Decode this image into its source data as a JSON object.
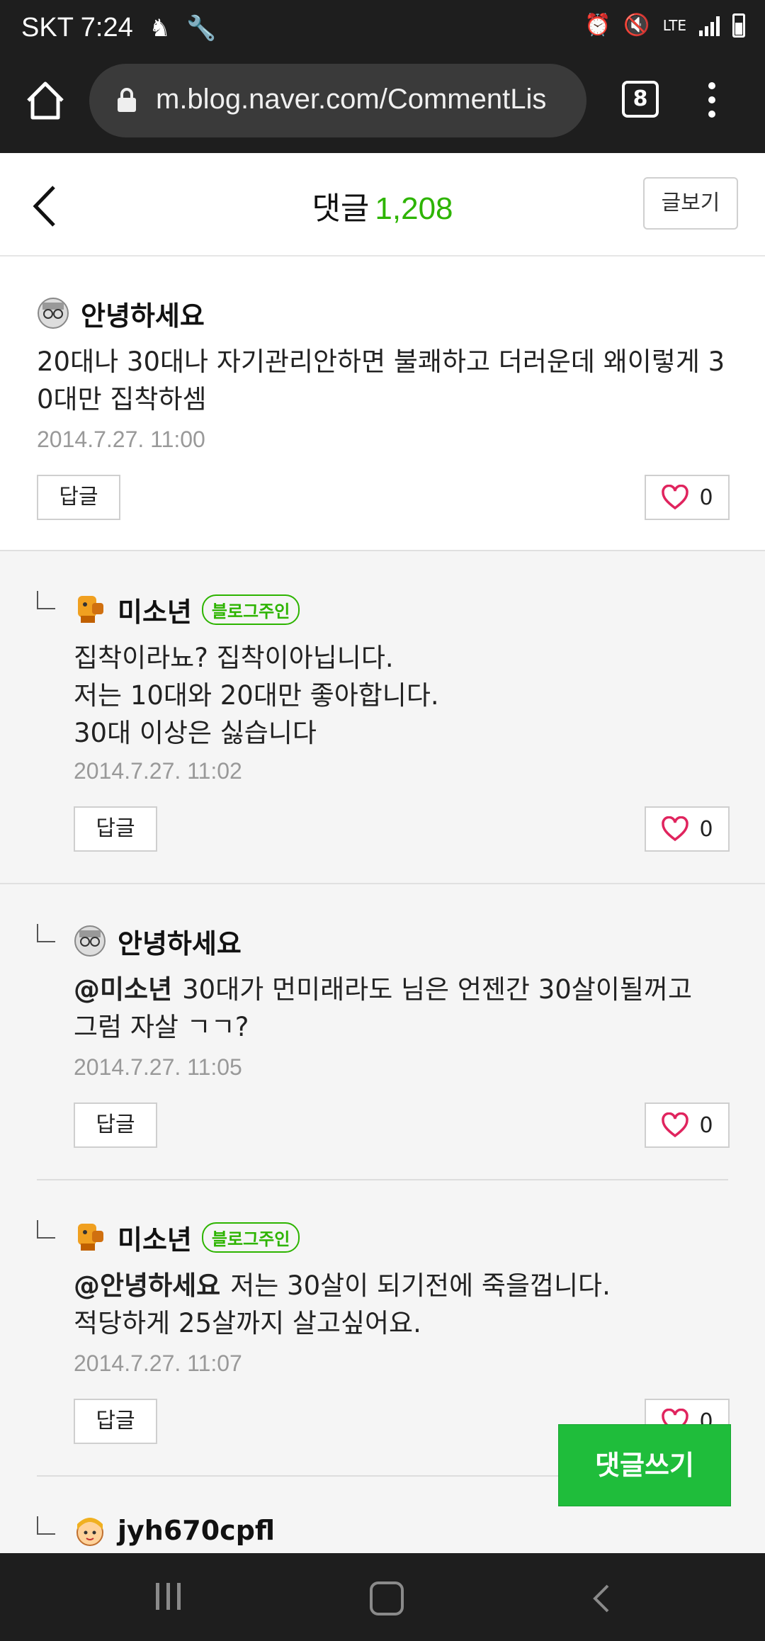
{
  "status_bar": {
    "carrier": "SKT",
    "time": "7:24",
    "network": "LTE"
  },
  "browser": {
    "url": "m.blog.naver.com/CommentLis",
    "tab_count": "8"
  },
  "header": {
    "title": "댓글",
    "count": "1,208",
    "view_post_label": "글보기"
  },
  "comments": [
    {
      "author": "안녕하세요",
      "text": "20대나 30대나 자기관리안하면 불쾌하고 더러운데 왜이렇게 3\n0대만 집착하셈",
      "date": "2014.7.27. 11:00",
      "reply_label": "답글",
      "likes": "0"
    },
    {
      "author": "미소년",
      "badge": "블로그주인",
      "text": "집착이라뇨? 집착이아닙니다.\n저는 10대와 20대만 좋아합니다.\n30대 이상은 싫습니다",
      "date": "2014.7.27. 11:02",
      "reply_label": "답글",
      "likes": "0"
    },
    {
      "author": "안녕하세요",
      "mention": "@미소년",
      "text": "30대가 먼미래라도 님은 언젠간 30살이될꺼고\n그럼 자살 ㄱㄱ?",
      "date": "2014.7.27. 11:05",
      "reply_label": "답글",
      "likes": "0"
    },
    {
      "author": "미소년",
      "badge": "블로그주인",
      "mention": "@안녕하세요",
      "text": "저는 30살이 되기전에 죽을껍니다.\n적당하게 25살까지 살고싶어요.",
      "date": "2014.7.27. 11:07",
      "reply_label": "답글",
      "likes": "0"
    },
    {
      "author": "jyh670cpfl"
    }
  ],
  "fab": {
    "write_comment_label": "댓글쓰기"
  },
  "colors": {
    "accent": "#2db400",
    "fab": "#1fbd3b",
    "heart": "#e0245e"
  }
}
